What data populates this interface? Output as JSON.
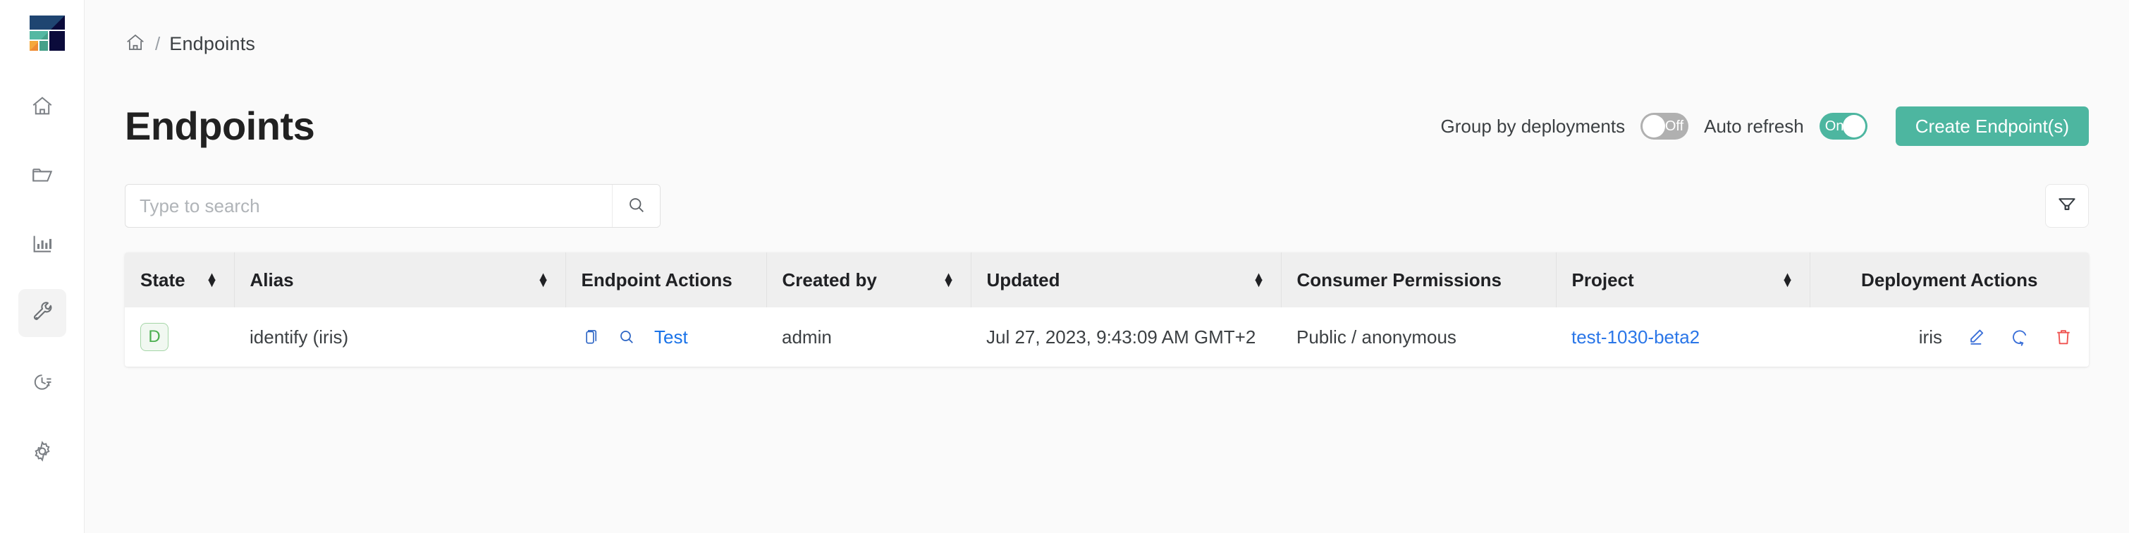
{
  "sidebar": {
    "logo_name": "platform-logo",
    "items": [
      {
        "name": "sidebar-item-home",
        "icon": "home-icon",
        "active": false
      },
      {
        "name": "sidebar-item-projects",
        "icon": "folder-icon",
        "active": false
      },
      {
        "name": "sidebar-item-analytics",
        "icon": "bar-chart-icon",
        "active": false
      },
      {
        "name": "sidebar-item-endpoints",
        "icon": "wrench-icon",
        "active": true
      },
      {
        "name": "sidebar-item-history",
        "icon": "clock-history-icon",
        "active": false
      },
      {
        "name": "sidebar-item-settings",
        "icon": "gear-icon",
        "active": false
      }
    ]
  },
  "breadcrumb": {
    "home_icon": "home-icon",
    "separator": "/",
    "current": "Endpoints"
  },
  "header": {
    "title": "Endpoints",
    "group_by_label": "Group by deployments",
    "group_by_state": "Off",
    "auto_refresh_label": "Auto refresh",
    "auto_refresh_state": "On",
    "create_button": "Create Endpoint(s)"
  },
  "search": {
    "value": "",
    "placeholder": "Type to search",
    "search_icon": "search-icon",
    "filter_icon": "filter-icon"
  },
  "table": {
    "columns": [
      {
        "label": "State",
        "sortable": true,
        "align": "left"
      },
      {
        "label": "Alias",
        "sortable": true,
        "align": "left"
      },
      {
        "label": "Endpoint Actions",
        "sortable": false,
        "align": "left"
      },
      {
        "label": "Created by",
        "sortable": true,
        "align": "left"
      },
      {
        "label": "Updated",
        "sortable": true,
        "align": "left"
      },
      {
        "label": "Consumer Permissions",
        "sortable": false,
        "align": "left"
      },
      {
        "label": "Project",
        "sortable": true,
        "align": "left"
      },
      {
        "label": "Deployment Actions",
        "sortable": false,
        "align": "center"
      }
    ],
    "rows": [
      {
        "state": "D",
        "alias": "identify (iris)",
        "endpoint_actions": {
          "copy_icon": "copy-icon",
          "inspect_icon": "search-icon",
          "test_link": "Test"
        },
        "created_by": "admin",
        "updated": "Jul 27, 2023, 9:43:09 AM GMT+2",
        "consumer_permissions": "Public / anonymous",
        "project": "test-1030-beta2",
        "deployment_name": "iris",
        "deployment_actions": {
          "edit_icon": "pencil-icon",
          "restart_icon": "refresh-icon",
          "delete_icon": "trash-icon"
        }
      }
    ]
  },
  "colors": {
    "accent_green": "#4db6a0",
    "link_blue": "#1a73e8",
    "danger_red": "#ef5350",
    "state_green": "#4caf50",
    "toggle_off": "#b0b0b0"
  }
}
